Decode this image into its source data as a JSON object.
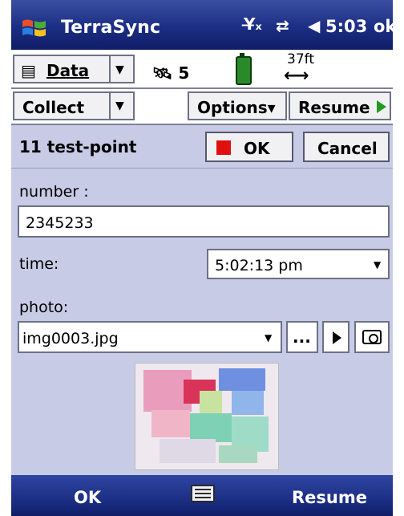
{
  "status_bar": {
    "title": "TerraSync",
    "clock": "5:03",
    "ok_label": "ok",
    "icons": [
      "windows-logo-icon",
      "signal-off-icon",
      "sync-icon",
      "volume-icon"
    ]
  },
  "toolbar1": {
    "data_label": "Data",
    "sat_count": "5",
    "accuracy": "37ft",
    "icons": [
      "document-icon",
      "satellite-icon",
      "battery-icon",
      "accuracy-arrows-icon"
    ]
  },
  "toolbar2": {
    "collect_label": "Collect",
    "options_label": "Options",
    "resume_label": "Resume"
  },
  "form": {
    "feature_title": "11 test-point",
    "ok_label": "OK",
    "cancel_label": "Cancel",
    "number_label": "number :",
    "number_value": "2345233",
    "time_label": "time:",
    "time_value": "5:02:13 pm",
    "photo_label": "photo:",
    "photo_value": "img0003.jpg",
    "browse_label": "..."
  },
  "softkeys": {
    "left": "OK",
    "right": "Resume"
  },
  "colors": {
    "top_bar": "#1c2e84",
    "form_bg": "#c8cbe6",
    "ok_square": "#e01010",
    "battery": "#2a8a2a",
    "resume_arrow": "#1f9a1f"
  }
}
